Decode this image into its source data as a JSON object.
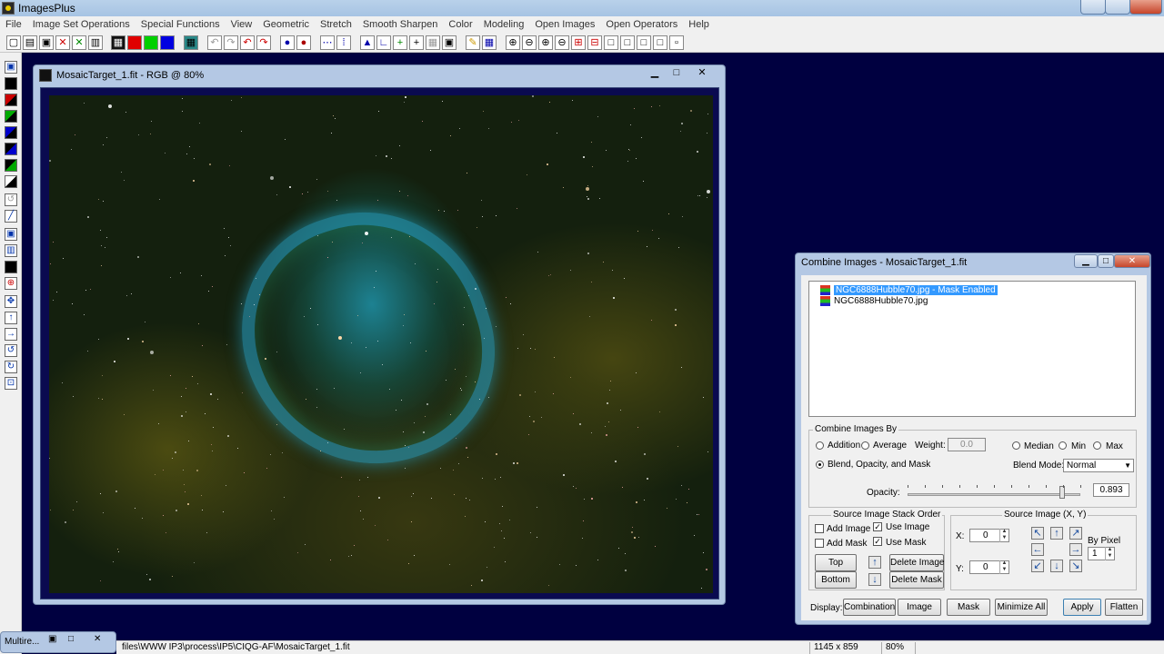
{
  "app": {
    "title": "ImagesPlus"
  },
  "menu": [
    "File",
    "Image Set Operations",
    "Special Functions",
    "View",
    "Geometric",
    "Stretch",
    "Smooth Sharpen",
    "Color",
    "Modeling",
    "Open Images",
    "Open Operators",
    "Help"
  ],
  "image_window": {
    "title": "MosaicTarget_1.fit - RGB @ 80%",
    "controls": {
      "minimize": "▁",
      "maximize": "□",
      "close": "✕"
    }
  },
  "combine": {
    "title": "Combine Images - MosaicTarget_1.fit",
    "list": [
      {
        "label": "NGC6888Hubble70.jpg - Mask Enabled",
        "selected": true
      },
      {
        "label": "NGC6888Hubble70.jpg",
        "selected": false
      }
    ],
    "combine_by": {
      "legend": "Combine Images By",
      "addition": "Addition",
      "average": "Average",
      "weight_label": "Weight:",
      "weight_value": "0.0",
      "median": "Median",
      "min": "Min",
      "max": "Max",
      "blend": "Blend, Opacity, and Mask",
      "blend_mode_label": "Blend Mode:",
      "blend_mode_value": "Normal",
      "opacity_label": "Opacity:",
      "opacity_value": "0.893",
      "opacity_fraction": 0.893
    },
    "stack": {
      "legend": "Source Image Stack Order",
      "add_image": "Add Image",
      "use_image": "Use Image",
      "add_mask": "Add Mask",
      "use_mask": "Use Mask",
      "top": "Top",
      "bottom": "Bottom",
      "delete_image": "Delete Image",
      "delete_mask": "Delete Mask"
    },
    "source_xy": {
      "legend": "Source Image (X, Y)",
      "x_label": "X:",
      "x_value": "0",
      "y_label": "Y:",
      "y_value": "0",
      "by_pixel_label": "By Pixel",
      "by_pixel_value": "1"
    },
    "display": {
      "label": "Display:",
      "combination": "Combination",
      "image": "Image",
      "mask": "Mask",
      "minimize_all": "Minimize All",
      "apply": "Apply",
      "flatten": "Flatten"
    }
  },
  "minimized": {
    "title": "Multire..."
  },
  "status": {
    "path": "files\\WWW IP3\\process\\IP5\\CIQG-AF\\MosaicTarget_1.fit",
    "dimensions": "1145 x 859",
    "zoom": "80%"
  }
}
